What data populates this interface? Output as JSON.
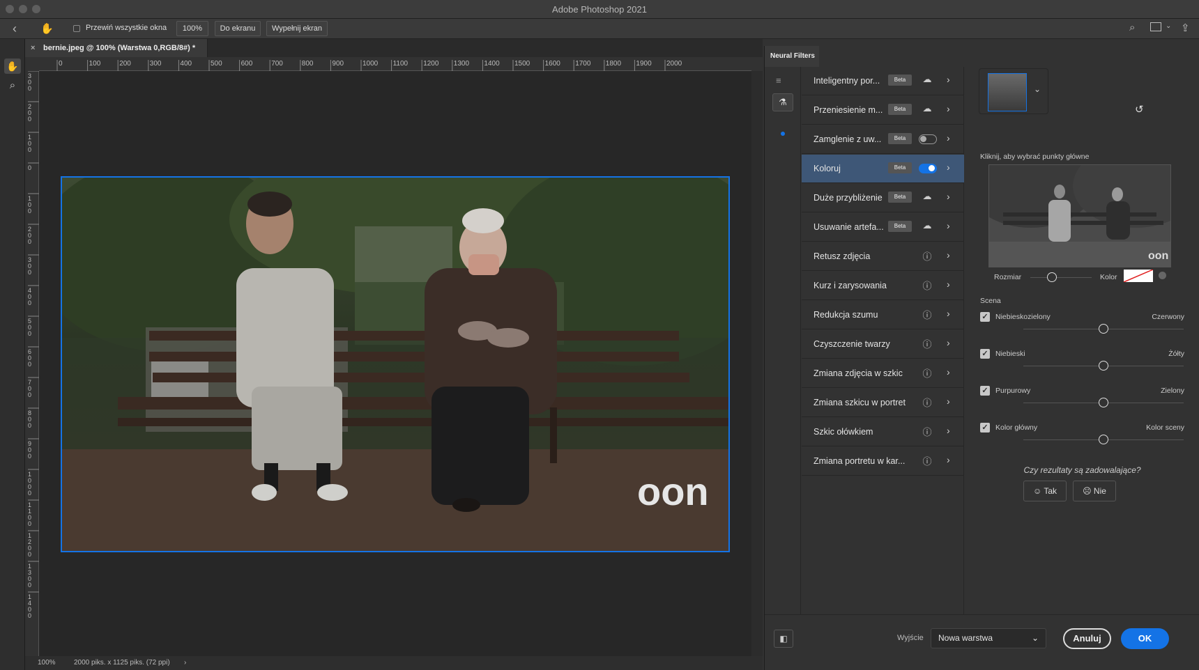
{
  "app": {
    "title": "Adobe Photoshop 2021"
  },
  "options": {
    "scroll_all": "Przewiń wszystkie okna",
    "zoom": "100%",
    "fit_screen": "Do ekranu",
    "fill_screen": "Wypełnij ekran"
  },
  "document": {
    "tab_title": "bernie.jpeg @ 100% (Warstwa 0,RGB/8#) *",
    "status_zoom": "100%",
    "status_info": "2000 piks. x 1125 piks. (72 ppi)"
  },
  "ruler": {
    "h_ticks": [
      "0",
      "100",
      "200",
      "300",
      "400",
      "500",
      "600",
      "700",
      "800",
      "900",
      "1000",
      "1100",
      "1200",
      "1300",
      "1400",
      "1500",
      "1600",
      "1700",
      "1800",
      "1900",
      "2000"
    ],
    "v_ticks": [
      "300",
      "200",
      "100",
      "0",
      "100",
      "200",
      "300",
      "400",
      "500",
      "600",
      "700",
      "800",
      "900",
      "1000",
      "1100",
      "1200",
      "1300",
      "1400"
    ]
  },
  "panel": {
    "title": "Neural Filters",
    "filters": [
      {
        "label": "Inteligentny por...",
        "beta": "Beta",
        "state": "cloud"
      },
      {
        "label": "Przeniesienie m...",
        "beta": "Beta",
        "state": "cloud"
      },
      {
        "label": "Zamglenie z uw...",
        "beta": "Beta",
        "state": "off"
      },
      {
        "label": "Koloruj",
        "beta": "Beta",
        "state": "on"
      },
      {
        "label": "Duże przybliżenie",
        "beta": "Beta",
        "state": "cloud"
      },
      {
        "label": "Usuwanie artefa...",
        "beta": "Beta",
        "state": "cloud"
      },
      {
        "label": "Retusz zdjęcia",
        "beta": "",
        "state": "info"
      },
      {
        "label": "Kurz i zarysowania",
        "beta": "",
        "state": "info"
      },
      {
        "label": "Redukcja szumu",
        "beta": "",
        "state": "info"
      },
      {
        "label": "Czyszczenie twarzy",
        "beta": "",
        "state": "info"
      },
      {
        "label": "Zmiana zdjęcia w szkic",
        "beta": "",
        "state": "info"
      },
      {
        "label": "Zmiana szkicu w portret",
        "beta": "",
        "state": "info"
      },
      {
        "label": "Szkic ołówkiem",
        "beta": "",
        "state": "info"
      },
      {
        "label": "Zmiana portretu w kar...",
        "beta": "",
        "state": "info"
      }
    ],
    "settings": {
      "click_hint": "Kliknij, aby wybrać punkty główne",
      "size_label": "Rozmiar",
      "color_label": "Kolor",
      "size_value": 0.35,
      "scene_label": "Scena",
      "sliders": [
        {
          "left": "Niebieskozielony",
          "right": "Czerwony",
          "value": 0.5
        },
        {
          "left": "Niebieski",
          "right": "Żółty",
          "value": 0.5
        },
        {
          "left": "Purpurowy",
          "right": "Zielony",
          "value": 0.5
        },
        {
          "left": "Kolor główny",
          "right": "Kolor sceny",
          "value": 0.5
        }
      ],
      "feedback_question": "Czy rezultaty są zadowalające?",
      "yes": "Tak",
      "no": "Nie"
    },
    "footer": {
      "output_label": "Wyjście",
      "output_value": "Nowa warstwa",
      "cancel": "Anuluj",
      "ok": "OK"
    }
  },
  "watermark": {
    "text": "oon"
  },
  "colors": {
    "accent": "#1473e6",
    "active_row": "#3e5777",
    "panel_bg": "#323232"
  }
}
